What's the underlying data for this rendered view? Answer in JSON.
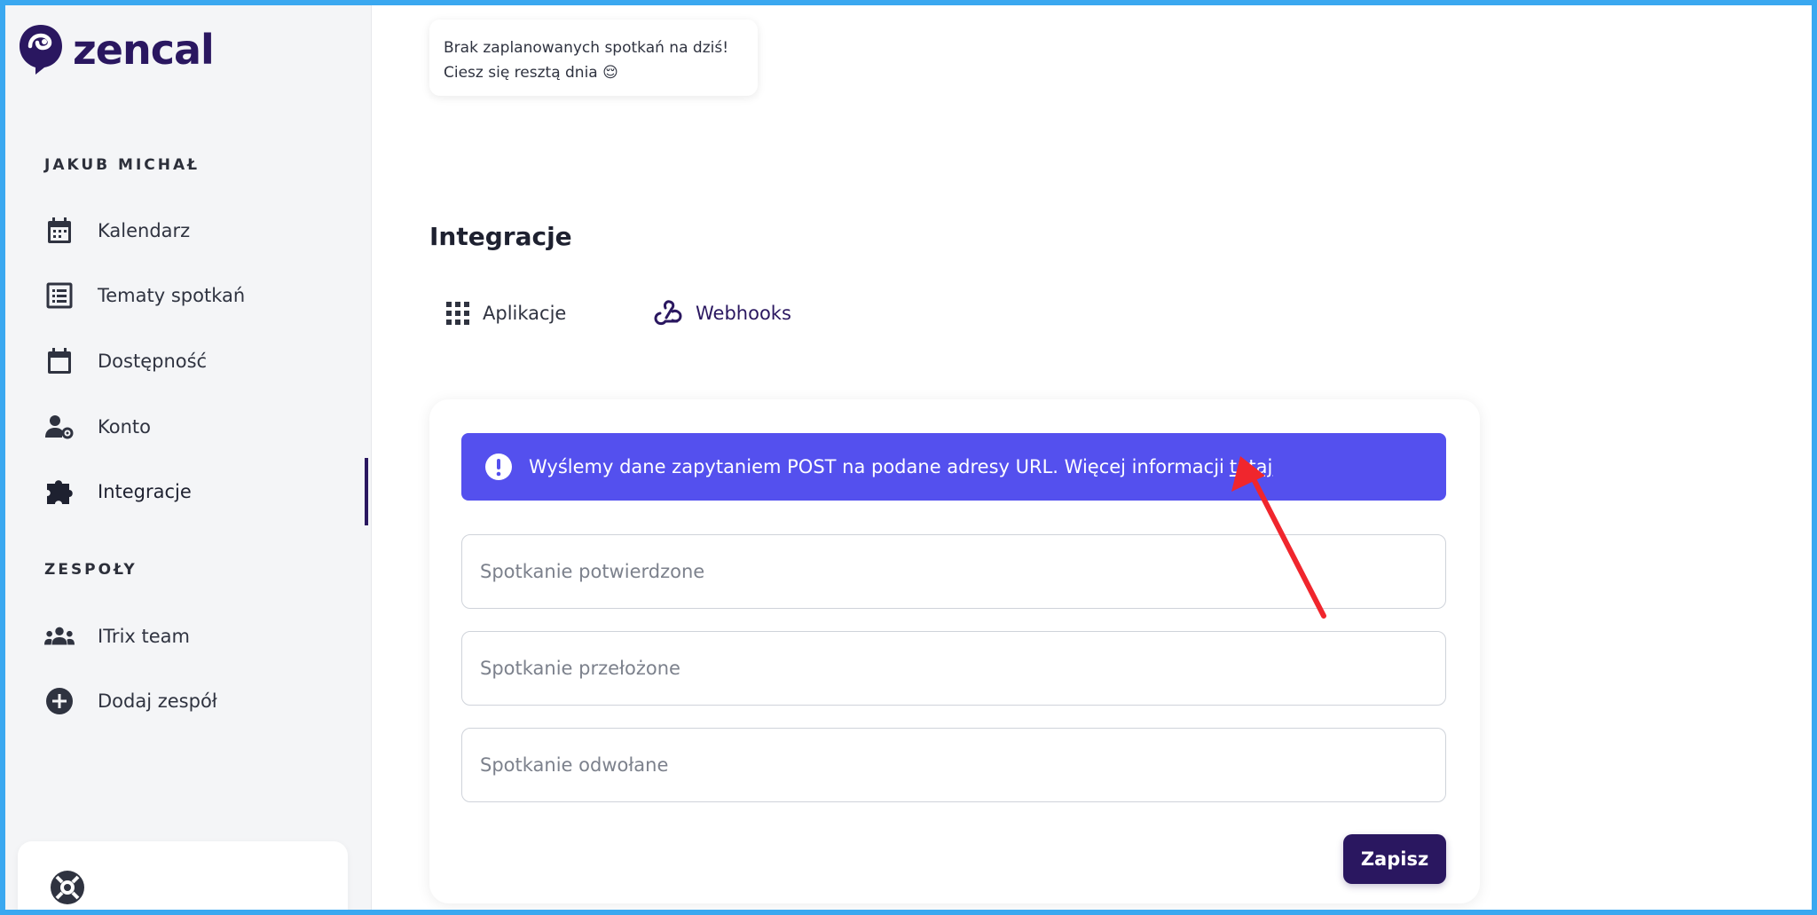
{
  "app": {
    "logo_text": "zencal"
  },
  "sidebar": {
    "user_section": "JAKUB MICHAŁ",
    "items": [
      {
        "label": "Kalendarz",
        "icon": "calendar-icon"
      },
      {
        "label": "Tematy spotkań",
        "icon": "list-icon"
      },
      {
        "label": "Dostępność",
        "icon": "calendar-blank-icon"
      },
      {
        "label": "Konto",
        "icon": "user-gear-icon"
      },
      {
        "label": "Integracje",
        "icon": "puzzle-icon",
        "active": true
      }
    ],
    "teams_section": "ZESPOŁY",
    "teams": [
      {
        "label": "ITrix team",
        "icon": "team-icon"
      },
      {
        "label": "Dodaj zespół",
        "icon": "plus-circle-icon"
      }
    ],
    "help_icon": "lifebuoy-icon"
  },
  "toast": {
    "line1": "Brak zaplanowanych spotkań na dziś!",
    "line2": "Ciesz się resztą dnia 😌"
  },
  "main": {
    "title": "Integracje",
    "tabs": [
      {
        "label": "Aplikacje",
        "icon": "grid-icon"
      },
      {
        "label": "Webhooks",
        "icon": "webhook-icon",
        "active": true
      }
    ],
    "banner": {
      "text": "Wyślemy dane zapytaniem POST na podane adresy URL. Więcej informacji",
      "link": "tutaj"
    },
    "fields": [
      {
        "placeholder": "Spotkanie potwierdzone",
        "value": ""
      },
      {
        "placeholder": "Spotkanie przełożone",
        "value": ""
      },
      {
        "placeholder": "Spotkanie odwołane",
        "value": ""
      }
    ],
    "save_label": "Zapisz"
  },
  "colors": {
    "brand": "#2a1760",
    "banner": "#5450ee",
    "frame": "#3aa8f0",
    "annotation_arrow": "#f0262d"
  }
}
